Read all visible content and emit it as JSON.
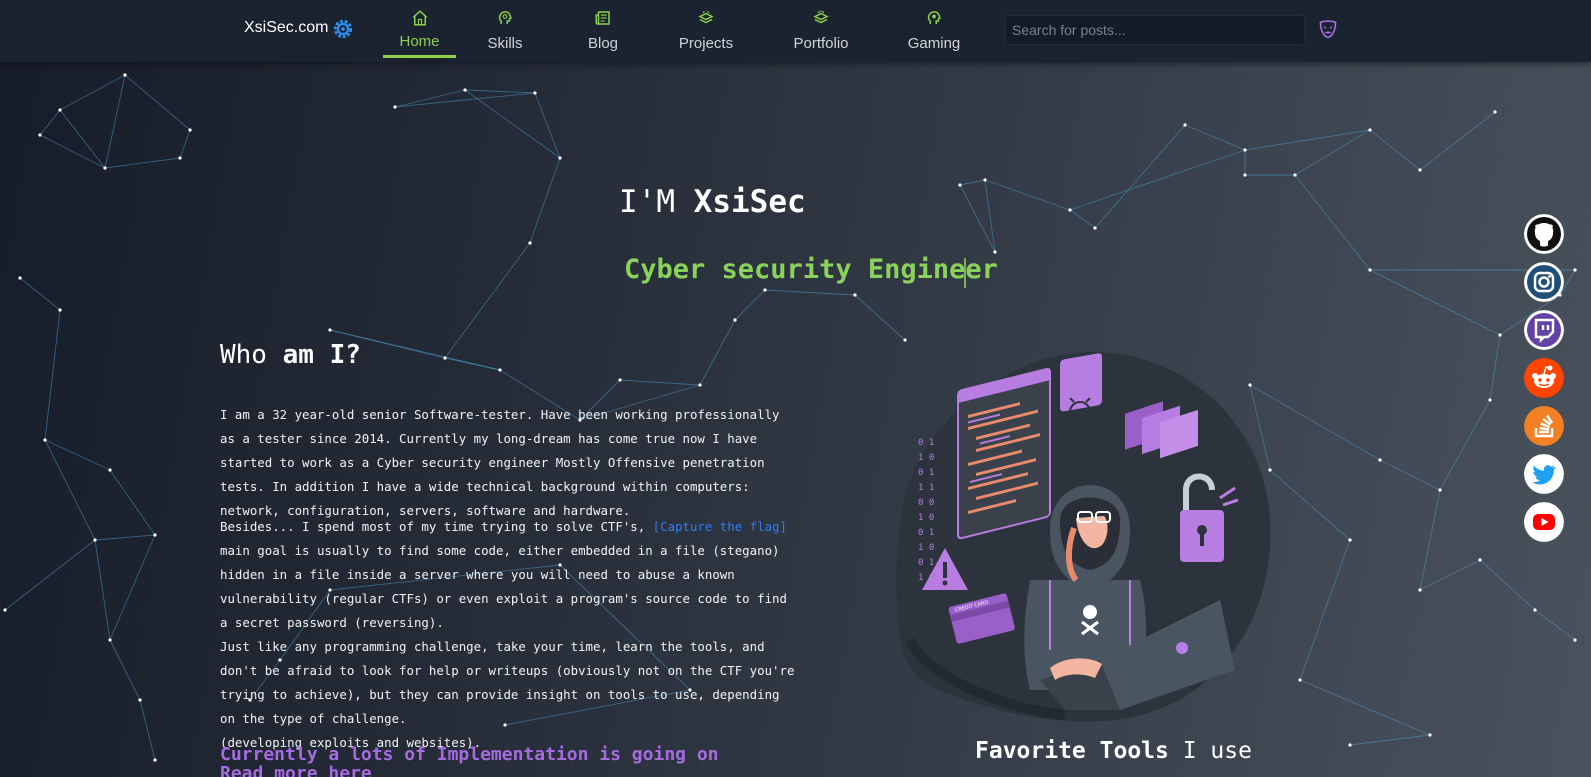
{
  "nav": {
    "brand": "XsiSec.com",
    "items": [
      {
        "label": "Home",
        "icon": "home-icon"
      },
      {
        "label": "Skills",
        "icon": "brain-icon"
      },
      {
        "label": "Blog",
        "icon": "newspaper-icon"
      },
      {
        "label": "Projects",
        "icon": "projects-icon"
      },
      {
        "label": "Portfolio",
        "icon": "portfolio-icon"
      },
      {
        "label": "Gaming",
        "icon": "gaming-icon"
      }
    ],
    "active": "Home",
    "search_placeholder": "Search for posts..."
  },
  "hero": {
    "title_prefix": "I'M",
    "title_name": "XsiSec",
    "role": "Cyber security Engineer"
  },
  "about": {
    "title_prefix": "Who",
    "title_bold": "am I?",
    "p1": "I am a 32 year-old senior Software-tester. Have been working professionally as a tester since 2014. Currently my long-dream has come true now I have started to work as a Cyber security engineer Mostly Offensive penetration tests. In addition I have a wide technical background within computers: network, configuration, servers, software and hardware.",
    "p2_before": "Besides... I spend most of my time trying to solve CTF's, ",
    "p2_link": "[Capture the flag]",
    "p2_after": " main goal is usually to find some code, either embedded in a file (stegano) hidden in a file inside a server where you will need to abuse a known vulnerability (regular CTFs) or even exploit a program's source code to find a secret password (reversing).",
    "p3": "Just like any programming challenge, take your time, learn the tools, and don't be afraid to look for help or writeups (obviously not on the CTF you're trying to achieve), but they can provide insight on tools to use, depending on the type of challenge.",
    "p4": "(developing exploits and websites).",
    "impl_line1": "Currently a lots of Implementation is going on",
    "impl_line2": "Read more here"
  },
  "tools": {
    "title_bold": "Favorite Tools",
    "title_rest": " I use"
  },
  "social": [
    {
      "name": "github",
      "color": "#ffffff"
    },
    {
      "name": "instagram",
      "color": "#ffffff"
    },
    {
      "name": "twitch",
      "color": "#6441a5"
    },
    {
      "name": "reddit",
      "color": "#ff4500"
    },
    {
      "name": "stackoverflow",
      "color": "#f48024"
    },
    {
      "name": "twitter",
      "color": "#1da1f2"
    },
    {
      "name": "youtube",
      "color": "#ffffff"
    }
  ],
  "colors": {
    "accent_green": "#8cd04a",
    "role_green": "#8ad25a",
    "link_blue": "#2f7ef0",
    "purple": "#a66be0",
    "navbar": "#1b2330"
  }
}
